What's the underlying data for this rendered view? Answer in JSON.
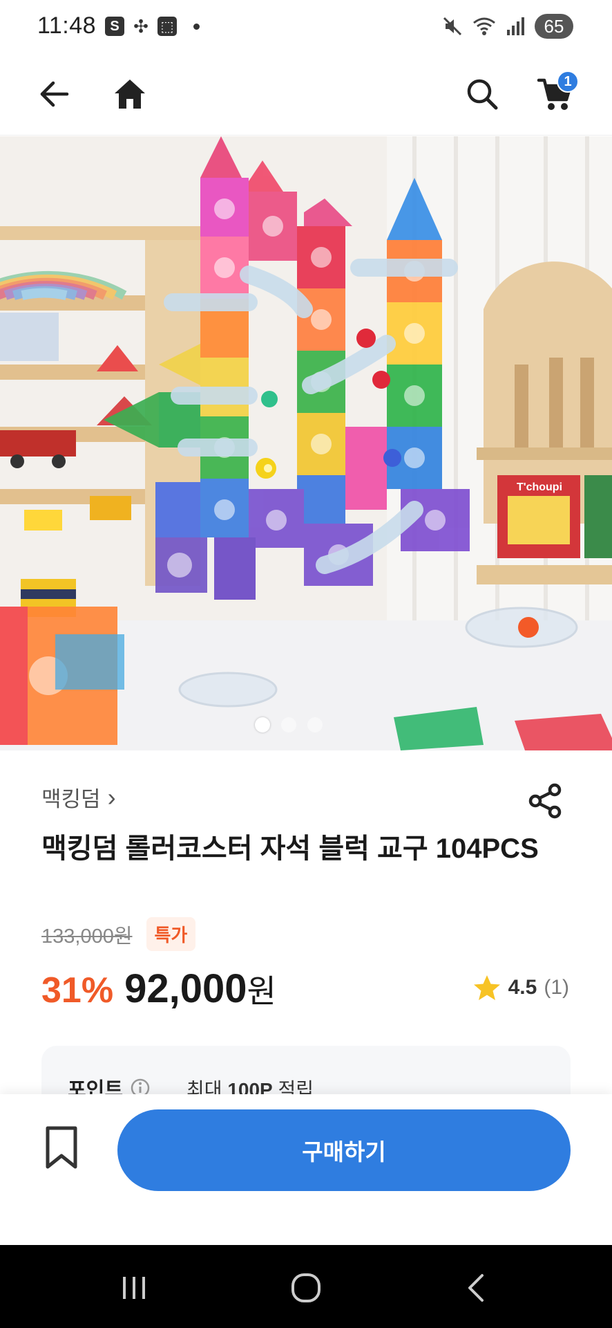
{
  "status_bar": {
    "time": "11:48",
    "left_icons": [
      "S",
      "✣",
      "⬚"
    ],
    "battery": "65"
  },
  "app_bar": {
    "back_icon": "arrow-left-icon",
    "home_icon": "home-icon",
    "search_icon": "search-icon",
    "cart_icon": "cart-icon",
    "cart_count": "1"
  },
  "hero": {
    "image_count": 3,
    "active_index": 0,
    "book_title": "T'choupi"
  },
  "product": {
    "brand": "맥킹덤",
    "brand_chevron": "›",
    "title": "맥킹덤 롤러코스터 자석 블럭 교구 104PCS",
    "original_price": "133,000원",
    "special_label": "특가",
    "discount": "31%",
    "price_number": "92,000",
    "price_unit": "원",
    "rating_value": "4.5",
    "rating_count": "(1)"
  },
  "points": {
    "label": "포인트",
    "prefix": "최대",
    "amount": "100P",
    "suffix": "적립"
  },
  "actions": {
    "buy_label": "구매하기"
  },
  "colors": {
    "accent_blue": "#2f7de0",
    "discount_orange": "#f05a28",
    "star_yellow": "#f7c325"
  }
}
